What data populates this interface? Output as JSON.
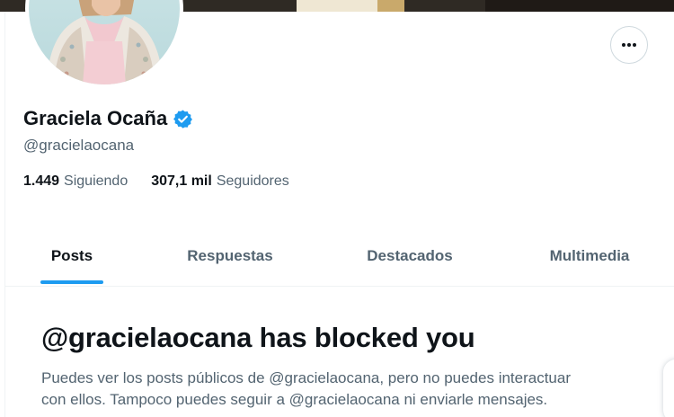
{
  "colors": {
    "accent": "#1d9bf0",
    "text_primary": "#0f1419",
    "text_secondary": "#536471",
    "border": "#cfd9de"
  },
  "header": {
    "more_icon": "more-horizontal-icon"
  },
  "profile": {
    "display_name": "Graciela Ocaña",
    "verified_icon": "verified-badge-icon",
    "handle": "@gracielaocana",
    "following_count": "1.449",
    "following_label": "Siguiendo",
    "followers_count": "307,1 mil",
    "followers_label": "Seguidores"
  },
  "tabs": [
    {
      "label": "Posts",
      "active": true
    },
    {
      "label": "Respuestas",
      "active": false
    },
    {
      "label": "Destacados",
      "active": false
    },
    {
      "label": "Multimedia",
      "active": false
    }
  ],
  "blocked": {
    "title": "@gracielaocana has blocked you",
    "line1": "Puedes ver los posts públicos de @gracielaocana, pero no puedes interactuar",
    "line2": "con ellos. Tampoco puedes seguir a @gracielaocana ni enviarle mensajes."
  }
}
